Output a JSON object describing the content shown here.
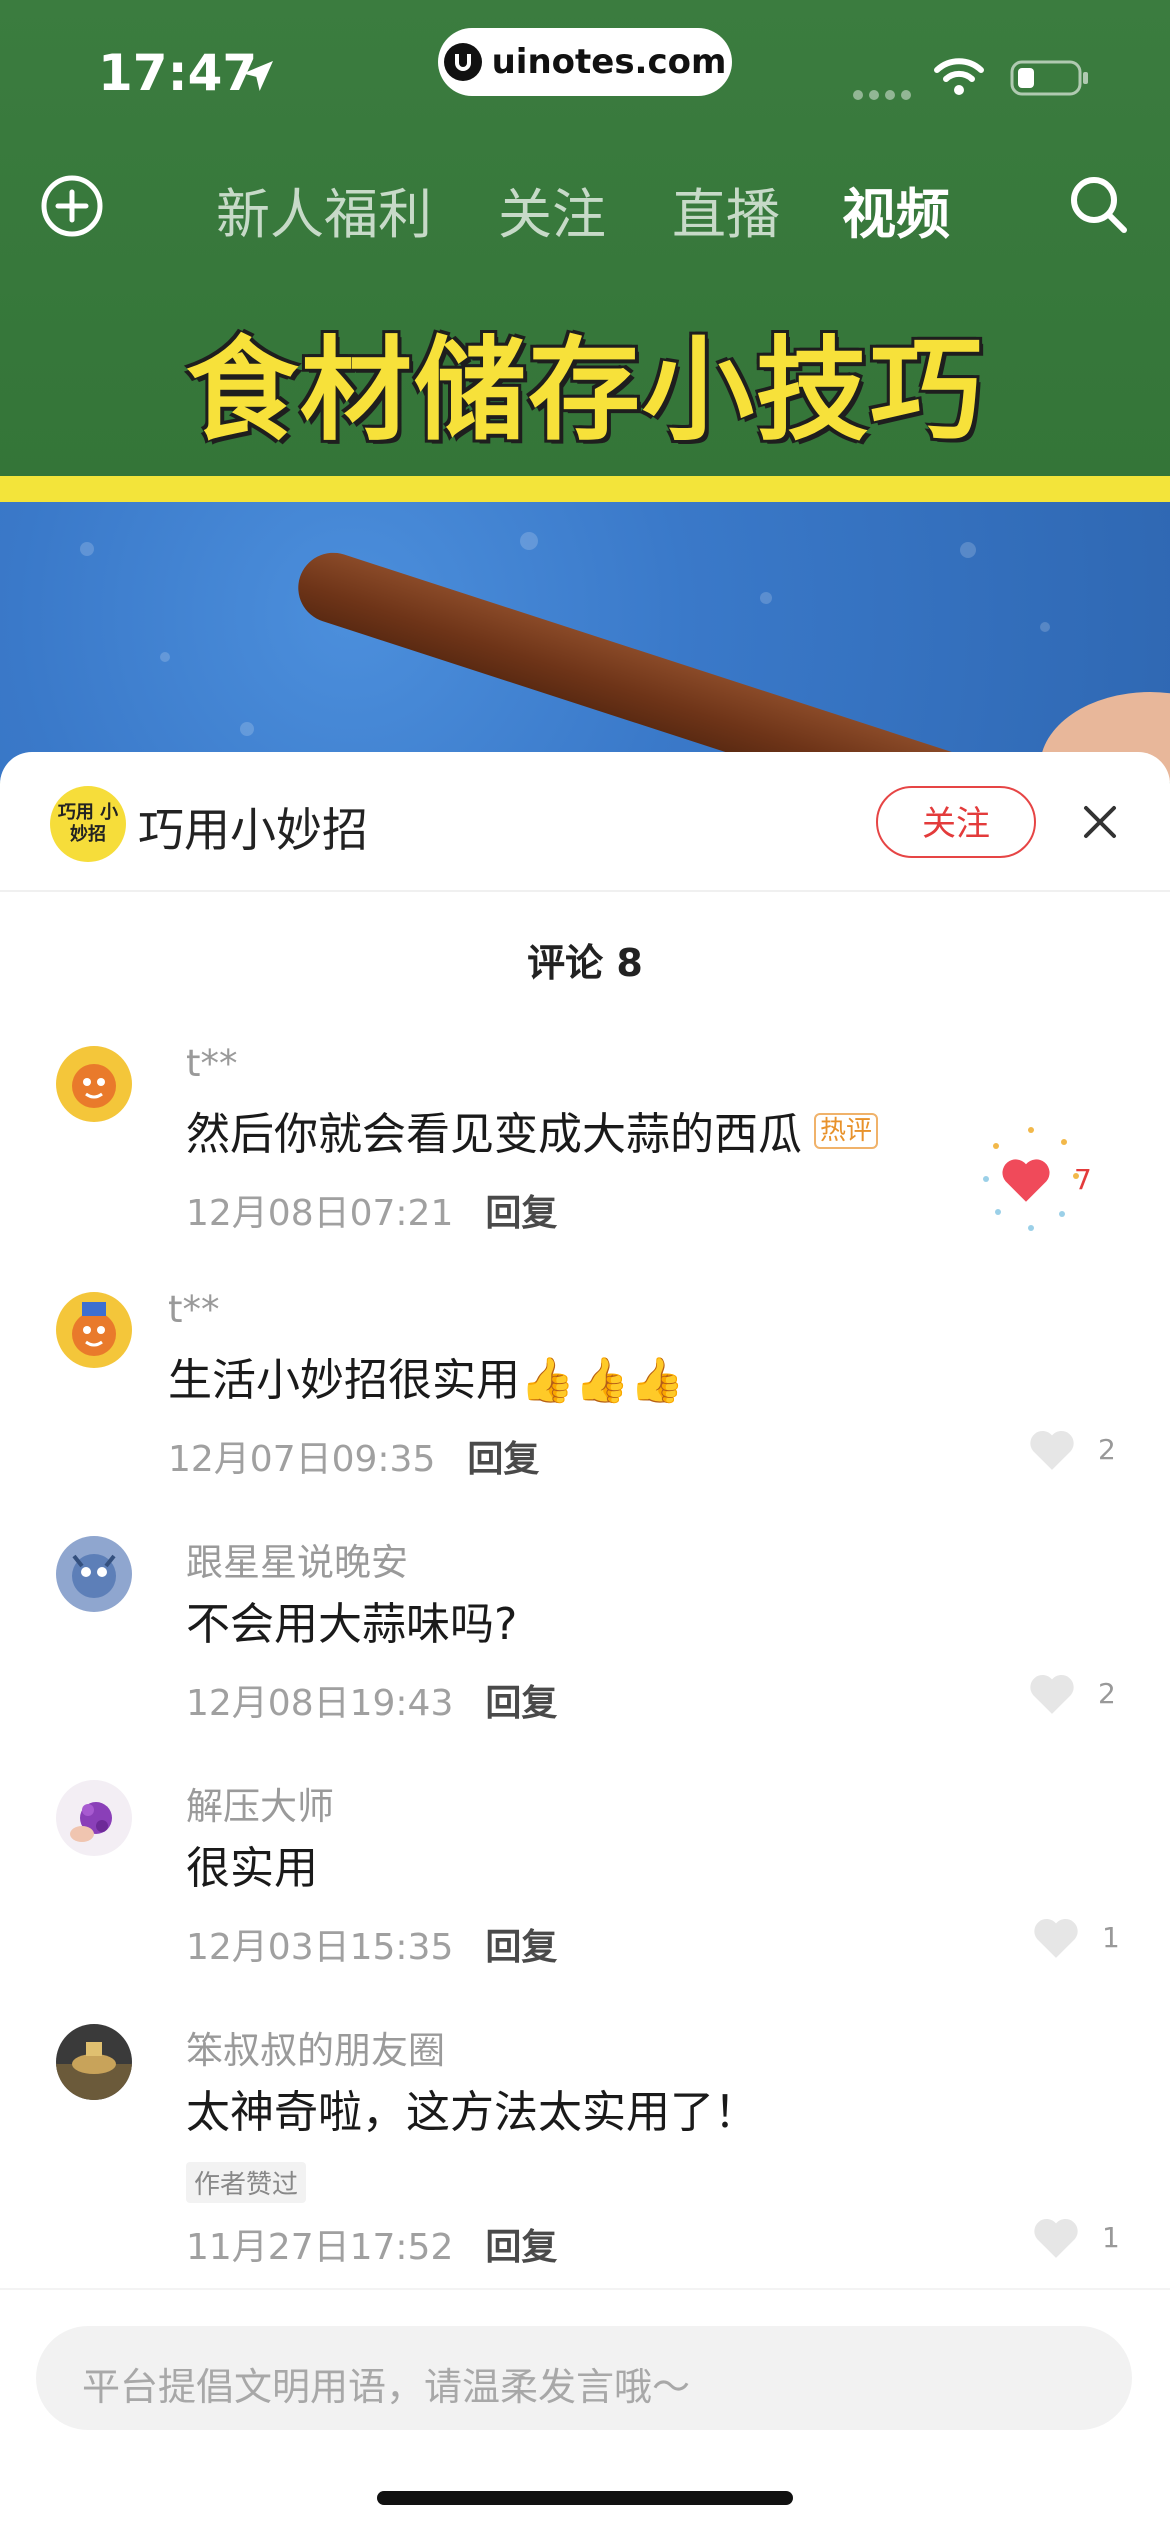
{
  "status_bar": {
    "time": "17:47",
    "url": "uinotes.com"
  },
  "nav": {
    "tabs": [
      {
        "label": "新人福利",
        "active": false
      },
      {
        "label": "关注",
        "active": false
      },
      {
        "label": "直播",
        "active": false
      },
      {
        "label": "视频",
        "active": true
      }
    ]
  },
  "video": {
    "title": "食材储存小技巧"
  },
  "sheet": {
    "author_avatar_text": "巧用 小妙招",
    "author_name": "巧用小妙招",
    "follow_label": "关注",
    "comments_title": "评论 8"
  },
  "comments": [
    {
      "user": "t**",
      "text": "然后你就会看见变成大蒜的西瓜",
      "badge": "热评",
      "time": "12月08日07:21",
      "reply": "回复",
      "likes": "7",
      "liked": true
    },
    {
      "user": "t**",
      "text": "生活小妙招很实用👍👍👍",
      "time": "12月07日09:35",
      "reply": "回复",
      "likes": "2",
      "liked": false
    },
    {
      "user": "跟星星说晚安",
      "text": "不会用大蒜味吗?",
      "time": "12月08日19:43",
      "reply": "回复",
      "likes": "2",
      "liked": false
    },
    {
      "user": "解压大师",
      "text": "很实用",
      "time": "12月03日15:35",
      "reply": "回复",
      "likes": "1",
      "liked": false
    },
    {
      "user": "笨叔叔的朋友圈",
      "text": "太神奇啦，这方法太实用了！",
      "author_liked": "作者赞过",
      "time": "11月27日17:52",
      "reply": "回复",
      "likes": "1",
      "liked": false
    }
  ],
  "input": {
    "placeholder": "平台提倡文明用语，请温柔发言哦～"
  },
  "colors": {
    "accent_red": "#e33b3b",
    "header_green": "#3b7c3f",
    "title_yellow": "#f7e13a"
  }
}
